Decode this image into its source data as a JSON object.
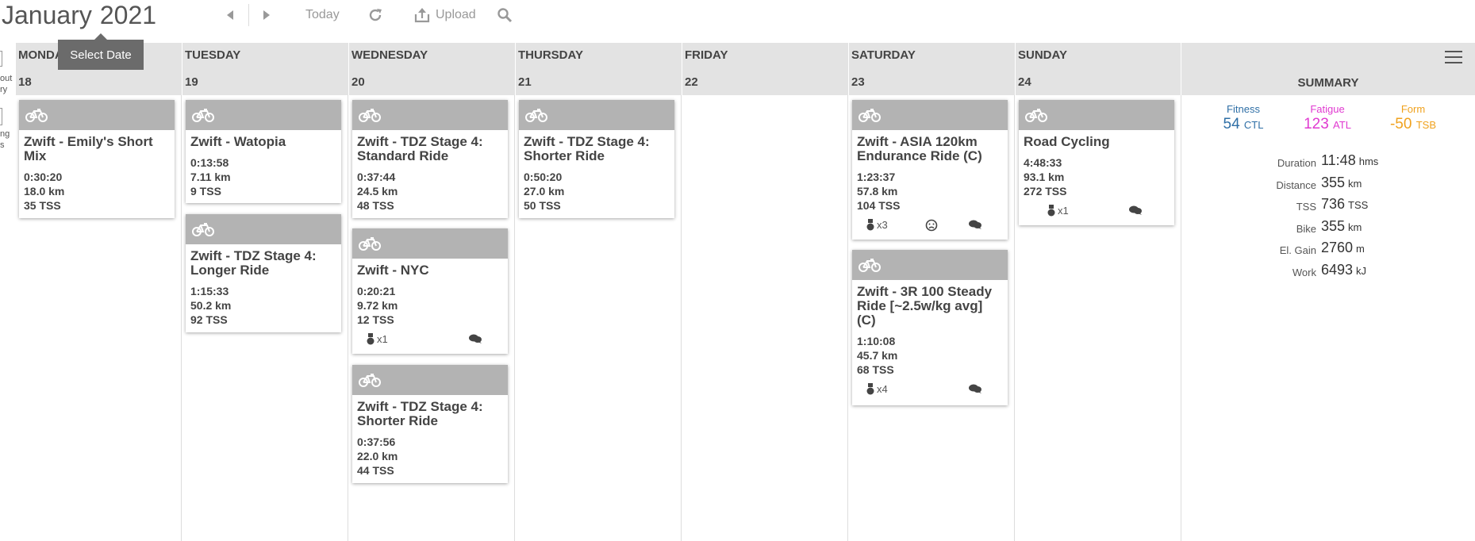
{
  "toolbar": {
    "month": "January",
    "year": "2021",
    "today_label": "Today",
    "upload_label": "Upload",
    "tooltip": "Select Date"
  },
  "left_panel": {
    "text_top": "out\nry",
    "text_bottom": "ng\ns"
  },
  "days": [
    {
      "name": "MONDAY",
      "name_visible": "MONDA",
      "num": "18"
    },
    {
      "name": "TUESDAY",
      "num": "19"
    },
    {
      "name": "WEDNESDAY",
      "num": "20"
    },
    {
      "name": "THURSDAY",
      "num": "21"
    },
    {
      "name": "FRIDAY",
      "num": "22"
    },
    {
      "name": "SATURDAY",
      "num": "23"
    },
    {
      "name": "SUNDAY",
      "num": "24"
    }
  ],
  "workouts": [
    {
      "day": 0,
      "title": "Zwift - Emily's Short Mix",
      "duration": "0:30:20",
      "distance": "18.0 km",
      "tss": "35 TSS"
    },
    {
      "day": 1,
      "title": "Zwift - Watopia",
      "duration": "0:13:58",
      "distance": "7.11 km",
      "tss": "9 TSS"
    },
    {
      "day": 1,
      "title": "Zwift - TDZ Stage 4: Longer Ride",
      "duration": "1:15:33",
      "distance": "50.2 km",
      "tss": "92 TSS"
    },
    {
      "day": 2,
      "title": "Zwift - TDZ Stage 4: Standard Ride",
      "duration": "0:37:44",
      "distance": "24.5 km",
      "tss": "48 TSS"
    },
    {
      "day": 2,
      "title": "Zwift - NYC",
      "duration": "0:20:21",
      "distance": "9.72 km",
      "tss": "12 TSS",
      "medals": "x1",
      "comments": true
    },
    {
      "day": 2,
      "title": "Zwift - TDZ Stage 4: Shorter Ride",
      "duration": "0:37:56",
      "distance": "22.0 km",
      "tss": "44 TSS"
    },
    {
      "day": 3,
      "title": "Zwift - TDZ Stage 4: Shorter Ride",
      "duration": "0:50:20",
      "distance": "27.0 km",
      "tss": "50 TSS"
    },
    {
      "day": 5,
      "title": "Zwift - ASIA 120km Endurance Ride (C)",
      "duration": "1:23:37",
      "distance": "57.8 km",
      "tss": "104 TSS",
      "medals": "x3",
      "feeling": "frown",
      "comments": true
    },
    {
      "day": 5,
      "title": "Zwift - 3R 100 Steady Ride [~2.5w/kg avg] (C)",
      "duration": "1:10:08",
      "distance": "45.7 km",
      "tss": "68 TSS",
      "medals": "x4",
      "comments": true
    },
    {
      "day": 6,
      "title": "Road Cycling",
      "duration": "4:48:33",
      "distance": "93.1 km",
      "tss": "272 TSS",
      "medals": "x1",
      "comments": true
    }
  ],
  "summary": {
    "title": "SUMMARY",
    "fitness": {
      "label": "Fitness",
      "value": "54",
      "unit": "CTL",
      "color": "#2f6fa6"
    },
    "fatigue": {
      "label": "Fatigue",
      "value": "123",
      "unit": "ATL",
      "color": "#e03ad0"
    },
    "form": {
      "label": "Form",
      "value": "-50",
      "unit": "TSB",
      "color": "#f0a21e"
    },
    "rows": [
      {
        "label": "Duration",
        "value": "11:48",
        "unit": "hms"
      },
      {
        "label": "Distance",
        "value": "355",
        "unit": "km"
      },
      {
        "label": "TSS",
        "value": "736",
        "unit": "TSS"
      },
      {
        "label": "Bike",
        "value": "355",
        "unit": "km"
      },
      {
        "label": "El. Gain",
        "value": "2760",
        "unit": "m"
      },
      {
        "label": "Work",
        "value": "6493",
        "unit": "kJ"
      }
    ]
  }
}
